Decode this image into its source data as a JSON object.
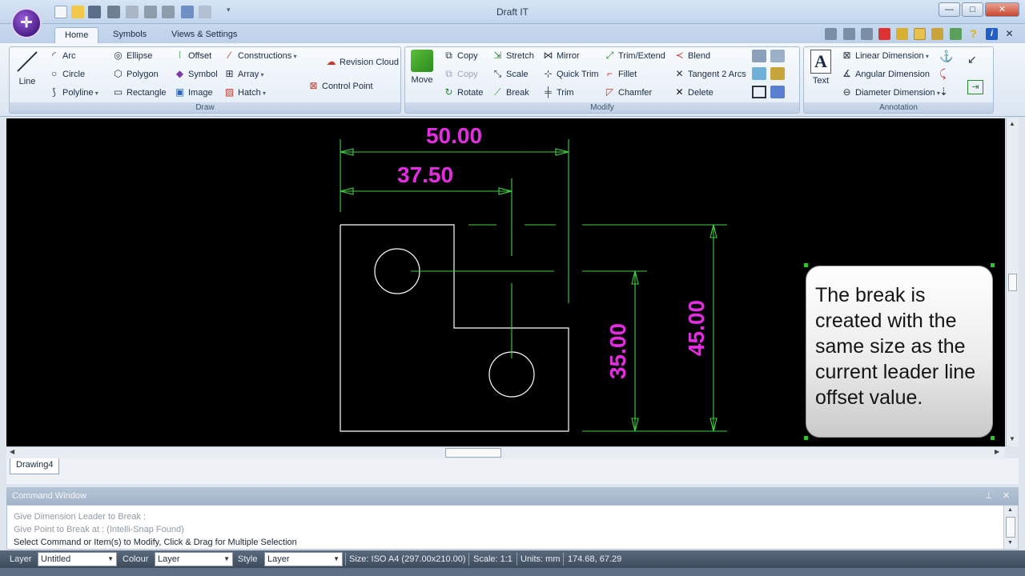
{
  "window": {
    "title": "Draft IT",
    "logo_glyph": "✛",
    "btn_minimize": "—",
    "btn_maximize": "□",
    "btn_close": "✕"
  },
  "tabs": [
    {
      "label": "Home"
    },
    {
      "label": "Symbols"
    },
    {
      "label": "Views & Settings"
    }
  ],
  "ribbon": {
    "draw": {
      "caption": "Draw",
      "line": "Line",
      "items": [
        {
          "label": "Arc",
          "icon": "arc-icon",
          "glyph": "◜"
        },
        {
          "label": "Circle",
          "icon": "circle-icon",
          "glyph": "○"
        },
        {
          "label": "Polyline",
          "icon": "polyline-icon",
          "glyph": "⟆"
        },
        {
          "label": "Ellipse",
          "icon": "ellipse-icon",
          "glyph": "◎"
        },
        {
          "label": "Polygon",
          "icon": "polygon-icon",
          "glyph": "⬡"
        },
        {
          "label": "Rectangle",
          "icon": "rectangle-icon",
          "glyph": "▭"
        },
        {
          "label": "Offset",
          "icon": "offset-icon",
          "glyph": "⦚"
        },
        {
          "label": "Symbol",
          "icon": "symbol-icon",
          "glyph": "◆"
        },
        {
          "label": "Image",
          "icon": "image-icon",
          "glyph": "▣"
        },
        {
          "label": "Constructions",
          "icon": "constructions-icon",
          "glyph": "∕"
        },
        {
          "label": "Array",
          "icon": "array-icon",
          "glyph": "⊞"
        },
        {
          "label": "Hatch",
          "icon": "hatch-icon",
          "glyph": "▨"
        },
        {
          "label": "Revision Cloud",
          "icon": "revision-cloud-icon",
          "glyph": "☁"
        },
        {
          "label": "Control Point",
          "icon": "control-point-icon",
          "glyph": "⊠"
        }
      ]
    },
    "modify": {
      "caption": "Modify",
      "move": "Move",
      "items": [
        {
          "label": "Copy",
          "icon": "copy-icon",
          "glyph": "⧉"
        },
        {
          "label": "Copy",
          "icon": "copy-disabled-icon",
          "glyph": "⧉"
        },
        {
          "label": "Rotate",
          "icon": "rotate-icon",
          "glyph": "↻"
        },
        {
          "label": "Stretch",
          "icon": "stretch-icon",
          "glyph": "⇲"
        },
        {
          "label": "Scale",
          "icon": "scale-icon",
          "glyph": "⤡"
        },
        {
          "label": "Break",
          "icon": "break-icon",
          "glyph": "⟋"
        },
        {
          "label": "Mirror",
          "icon": "mirror-icon",
          "glyph": "⋈"
        },
        {
          "label": "Quick Trim",
          "icon": "quick-trim-icon",
          "glyph": "⊹"
        },
        {
          "label": "Trim",
          "icon": "trim-icon",
          "glyph": "╪"
        },
        {
          "label": "Trim/Extend",
          "icon": "trim-extend-icon",
          "glyph": "⤢"
        },
        {
          "label": "Fillet",
          "icon": "fillet-icon",
          "glyph": "⌐"
        },
        {
          "label": "Chamfer",
          "icon": "chamfer-icon",
          "glyph": "◸"
        },
        {
          "label": "Blend",
          "icon": "blend-icon",
          "glyph": "≺"
        },
        {
          "label": "Tangent 2 Arcs",
          "icon": "tangent-arcs-icon",
          "glyph": "✕"
        },
        {
          "label": "Delete",
          "icon": "delete-icon",
          "glyph": "✕"
        }
      ]
    },
    "annotation": {
      "caption": "Annotation",
      "text": "Text",
      "text_glyph": "A",
      "items": [
        {
          "label": "Linear Dimension",
          "icon": "linear-dimension-icon",
          "glyph": "⊠"
        },
        {
          "label": "Angular Dimension",
          "icon": "angular-dimension-icon",
          "glyph": "∡"
        },
        {
          "label": "Diameter Dimension",
          "icon": "diameter-dimension-icon",
          "glyph": "⊖"
        }
      ]
    }
  },
  "drawing": {
    "dimensions": {
      "top_overall": "50.00",
      "top_partial": "37.50",
      "right_inner": "35.00",
      "right_outer": "45.00"
    },
    "colors": {
      "dimension_text": "#e32de0",
      "dimension_line": "#3fcf3f",
      "geometry": "#ffffff",
      "background": "#000000"
    }
  },
  "callout": {
    "text": "The break is created with the same size as the current leader line offset value."
  },
  "document_tab": {
    "label": "Drawing4"
  },
  "command_window": {
    "title": "Command Window",
    "lines": [
      "Give Dimension Leader to Break :",
      "Give Point to Break at :  (Intelli-Snap Found)",
      "Select Command or Item(s) to Modify, Click & Drag for Multiple Selection"
    ]
  },
  "status_bar": {
    "layer_label": "Layer",
    "layer_value": "Untitled",
    "colour_label": "Colour",
    "colour_value": "Layer",
    "style_label": "Style",
    "style_value": "Layer",
    "size": "Size: ISO A4 (297.00x210.00)",
    "scale": "Scale: 1:1",
    "units": "Units: mm",
    "coords": "174.68, 67.29"
  }
}
